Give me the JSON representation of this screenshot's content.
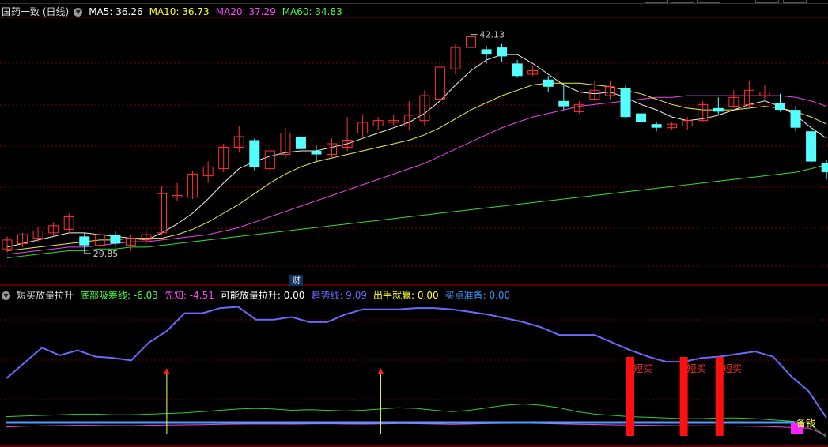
{
  "main": {
    "title": "国药一致 (日线)",
    "ma_labels": [
      {
        "text": "MA5: 36.26",
        "color": "#ffffff"
      },
      {
        "text": "MA10: 36.73",
        "color": "#ffff33"
      },
      {
        "text": "MA20: 37.29",
        "color": "#ff44ff"
      },
      {
        "text": "MA60: 34.83",
        "color": "#44ff44"
      }
    ],
    "high_label": "42.13",
    "low_label": "29.85",
    "badge": "财"
  },
  "indicator": {
    "title": "短买放量拉升",
    "labels": [
      {
        "text": "底部吸筹线: -6.03",
        "color": "#44ff44"
      },
      {
        "text": "先知: -4.51",
        "color": "#ff44ff"
      },
      {
        "text": "可能放量拉升: 0.00",
        "color": "#ffffff"
      },
      {
        "text": "趋势线: 9.09",
        "color": "#6a6aff"
      },
      {
        "text": "出手就赢: 0.00",
        "color": "#ffff33"
      },
      {
        "text": "买点准备: 0.00",
        "color": "#3399ff"
      }
    ],
    "signal_label": "短买",
    "end_label": "备钱"
  },
  "colors": {
    "up": "#ff3232",
    "down": "#54ffff",
    "grid": "#7a0000"
  },
  "chart_data": {
    "type": "candlestick",
    "price_range_label": [
      "29.85",
      "42.13"
    ],
    "candles": [
      [
        30.1,
        30.6,
        29.9,
        30.8
      ],
      [
        30.4,
        30.9,
        30.2,
        31.0
      ],
      [
        30.7,
        31.1,
        30.5,
        31.3
      ],
      [
        31.0,
        31.4,
        30.8,
        31.6
      ],
      [
        31.2,
        31.9,
        31.0,
        32.1
      ],
      [
        30.8,
        30.3,
        29.85,
        31.0
      ],
      [
        30.3,
        30.9,
        30.0,
        31.1
      ],
      [
        30.9,
        30.4,
        30.2,
        31.1
      ],
      [
        30.3,
        30.7,
        30.0,
        30.9
      ],
      [
        30.6,
        30.9,
        30.4,
        31.1
      ],
      [
        31.0,
        33.2,
        30.9,
        33.6
      ],
      [
        33.0,
        33.1,
        32.8,
        33.8
      ],
      [
        33.0,
        34.3,
        32.9,
        34.5
      ],
      [
        34.2,
        34.7,
        33.8,
        35.0
      ],
      [
        34.6,
        35.8,
        34.4,
        36.0
      ],
      [
        35.8,
        36.4,
        35.5,
        37.0
      ],
      [
        36.2,
        34.7,
        34.5,
        36.3
      ],
      [
        34.6,
        35.6,
        34.3,
        35.9
      ],
      [
        35.4,
        36.6,
        35.2,
        36.9
      ],
      [
        36.4,
        35.7,
        35.3,
        36.6
      ],
      [
        35.6,
        35.4,
        35.0,
        35.9
      ],
      [
        35.4,
        36.0,
        35.2,
        36.3
      ],
      [
        35.8,
        36.2,
        35.6,
        37.5
      ],
      [
        36.6,
        37.2,
        36.4,
        37.6
      ],
      [
        37.0,
        37.3,
        36.8,
        37.5
      ],
      [
        37.2,
        37.3,
        37.0,
        37.6
      ],
      [
        37.0,
        37.6,
        36.8,
        38.4
      ],
      [
        37.3,
        38.7,
        37.0,
        39.0
      ],
      [
        38.5,
        40.3,
        38.4,
        40.8
      ],
      [
        40.2,
        41.4,
        39.9,
        41.6
      ],
      [
        41.4,
        42.0,
        40.9,
        42.13
      ],
      [
        41.3,
        41.0,
        40.5,
        41.5
      ],
      [
        41.4,
        40.9,
        40.6,
        41.6
      ],
      [
        40.5,
        39.8,
        39.7,
        40.7
      ],
      [
        39.9,
        40.1,
        39.8,
        40.4
      ],
      [
        39.6,
        39.2,
        38.9,
        39.8
      ],
      [
        38.4,
        38.1,
        37.9,
        39.4
      ],
      [
        37.8,
        38.2,
        37.7,
        38.4
      ],
      [
        38.5,
        39.0,
        38.4,
        39.5
      ],
      [
        38.7,
        39.2,
        38.5,
        39.5
      ],
      [
        39.1,
        37.5,
        37.4,
        39.3
      ],
      [
        37.7,
        37.2,
        36.8,
        37.9
      ],
      [
        37.1,
        36.9,
        36.7,
        37.2
      ],
      [
        36.9,
        37.1,
        36.8,
        37.2
      ],
      [
        37.0,
        37.3,
        36.8,
        37.5
      ],
      [
        37.3,
        38.2,
        37.2,
        38.4
      ],
      [
        38.0,
        37.8,
        37.6,
        38.6
      ],
      [
        38.1,
        38.6,
        38.0,
        39.0
      ],
      [
        38.2,
        39.0,
        38.0,
        39.5
      ],
      [
        38.7,
        38.9,
        38.5,
        39.3
      ],
      [
        38.3,
        37.9,
        37.8,
        38.8
      ],
      [
        37.9,
        36.9,
        36.7,
        38.1
      ],
      [
        36.7,
        35.0,
        34.8,
        36.8
      ],
      [
        34.9,
        34.4,
        34.0,
        35.1
      ]
    ],
    "ma5": [
      30.2,
      30.4,
      30.6,
      30.8,
      31.0,
      31.0,
      30.9,
      30.8,
      30.7,
      30.6,
      31.0,
      31.5,
      32.1,
      32.9,
      33.8,
      34.6,
      35.0,
      35.3,
      35.5,
      35.6,
      35.6,
      35.8,
      36.0,
      36.3,
      36.6,
      36.9,
      37.2,
      37.7,
      38.4,
      39.3,
      40.1,
      40.7,
      41.0,
      41.0,
      40.5,
      39.9,
      39.3,
      38.9,
      38.8,
      38.9,
      38.6,
      38.2,
      37.9,
      37.5,
      37.3,
      37.4,
      37.6,
      37.9,
      38.2,
      38.4,
      38.1,
      37.6,
      36.9,
      36.3
    ],
    "ma10": [
      30.0,
      30.1,
      30.2,
      30.3,
      30.4,
      30.5,
      30.6,
      30.6,
      30.7,
      30.7,
      30.7,
      30.9,
      31.2,
      31.6,
      32.1,
      32.6,
      33.2,
      33.8,
      34.3,
      34.7,
      35.0,
      35.2,
      35.4,
      35.6,
      35.8,
      36.0,
      36.2,
      36.5,
      36.9,
      37.4,
      37.9,
      38.3,
      38.7,
      39.0,
      39.3,
      39.4,
      39.4,
      39.4,
      39.3,
      39.2,
      39.0,
      38.8,
      38.5,
      38.2,
      38.0,
      37.9,
      37.9,
      37.9,
      38.0,
      38.1,
      38.0,
      37.8,
      37.5,
      37.1
    ],
    "ma20": [
      29.8,
      29.9,
      30.0,
      30.1,
      30.2,
      30.2,
      30.3,
      30.4,
      30.5,
      30.5,
      30.6,
      30.7,
      30.8,
      30.9,
      31.1,
      31.3,
      31.6,
      31.9,
      32.2,
      32.5,
      32.8,
      33.1,
      33.4,
      33.7,
      34.0,
      34.3,
      34.6,
      34.9,
      35.3,
      35.7,
      36.1,
      36.5,
      36.9,
      37.2,
      37.5,
      37.7,
      37.9,
      38.1,
      38.2,
      38.3,
      38.4,
      38.5,
      38.6,
      38.6,
      38.7,
      38.7,
      38.7,
      38.7,
      38.7,
      38.7,
      38.7,
      38.6,
      38.4,
      38.1
    ],
    "ma60": [
      29.6,
      29.7,
      29.8,
      29.9,
      30.0,
      30.0,
      30.1,
      30.1,
      30.2,
      30.2,
      30.3,
      30.4,
      30.5,
      30.6,
      30.7,
      30.8,
      30.9,
      31.0,
      31.1,
      31.2,
      31.3,
      31.4,
      31.5,
      31.6,
      31.7,
      31.8,
      31.9,
      32.0,
      32.1,
      32.2,
      32.3,
      32.4,
      32.5,
      32.6,
      32.7,
      32.8,
      32.9,
      33.0,
      33.1,
      33.2,
      33.3,
      33.4,
      33.5,
      33.6,
      33.7,
      33.8,
      33.9,
      34.0,
      34.1,
      34.2,
      34.3,
      34.4,
      34.6,
      34.83
    ],
    "trend": [
      40,
      52,
      64,
      58,
      62,
      57,
      56,
      54,
      68,
      77,
      91,
      91,
      95,
      96,
      86,
      86,
      88,
      84,
      84,
      90,
      94,
      94,
      94,
      95,
      95,
      94,
      92,
      90,
      87,
      84,
      80,
      74,
      74,
      74,
      68,
      62,
      57,
      53,
      53,
      56,
      57,
      59,
      61,
      57,
      42,
      30,
      9.09
    ],
    "dibu": [
      10,
      10.5,
      11,
      11.5,
      12,
      12,
      11.5,
      11.5,
      12,
      12.5,
      13,
      14,
      15,
      16,
      16.5,
      16,
      15,
      15.5,
      15,
      14.5,
      15,
      16,
      17,
      16.5,
      15,
      14,
      15,
      17,
      19,
      20,
      19,
      17,
      14,
      12,
      11,
      10,
      9.5,
      9,
      8.5,
      8.5,
      9,
      9,
      8.5,
      7.5,
      6.5,
      5,
      -6.03
    ],
    "xianzhi": [
      2,
      2.5,
      2.8,
      3.0,
      3.2,
      3.1,
      3.0,
      2.9,
      3.2,
      3.4,
      3.6,
      3.8,
      4.0,
      4.2,
      4.4,
      4.3,
      4.2,
      4.4,
      4.5,
      4.3,
      4.2,
      4.4,
      4.6,
      4.5,
      4.3,
      4.1,
      4.3,
      4.6,
      4.8,
      4.9,
      4.7,
      4.4,
      4.1,
      3.9,
      3.6,
      3.4,
      3.2,
      3.0,
      2.9,
      2.8,
      2.7,
      2.6,
      2.4,
      2.1,
      1.6,
      1.0,
      -4.51
    ],
    "buyready": 0.0,
    "win_signal_indices": [
      9,
      21
    ],
    "short_buy_indices": [
      35,
      38,
      40
    ]
  }
}
